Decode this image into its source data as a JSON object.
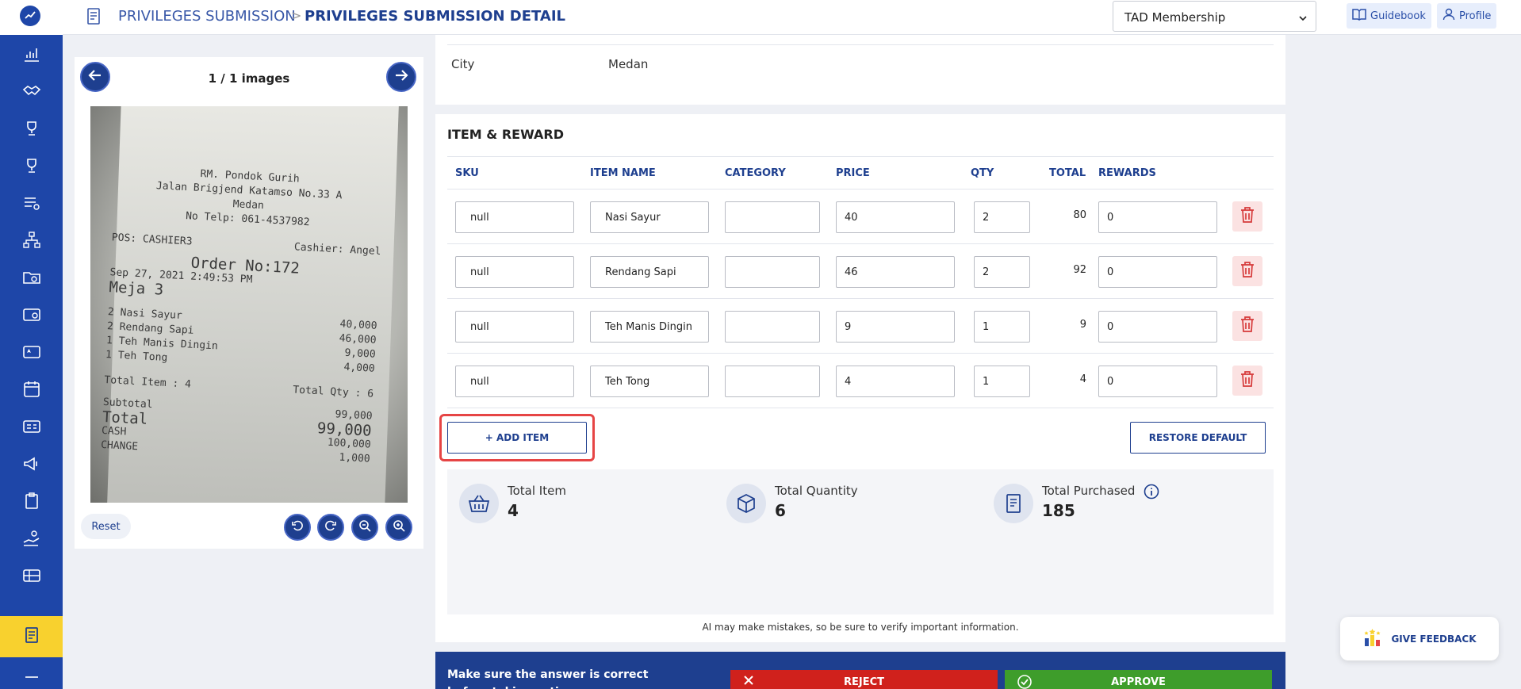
{
  "header": {
    "breadcrumb_parent": "PRIVILEGES SUBMISSION",
    "breadcrumb_separator": ">",
    "breadcrumb_current": "PRIVILEGES SUBMISSION DETAIL",
    "membership_select": "TAD Membership",
    "guidebook_label": "Guidebook",
    "profile_label": "Profile"
  },
  "sidebar": {
    "items": [
      {
        "icon": "chart-icon"
      },
      {
        "icon": "handshake-icon"
      },
      {
        "icon": "trophy-icon"
      },
      {
        "icon": "trophy-icon"
      },
      {
        "icon": "list-settings-icon"
      },
      {
        "icon": "hierarchy-icon"
      },
      {
        "icon": "folder-settings-icon"
      },
      {
        "icon": "card-settings-icon"
      },
      {
        "icon": "card-star-icon"
      },
      {
        "icon": "calendar-settings-icon"
      },
      {
        "icon": "id-card-icon"
      },
      {
        "icon": "megaphone-icon"
      },
      {
        "icon": "clipboard-icon"
      },
      {
        "icon": "hand-coins-icon"
      },
      {
        "icon": "card-gift-icon"
      },
      {
        "icon": "document-icon",
        "active": true
      }
    ]
  },
  "image_viewer": {
    "counter": "1 / 1 images",
    "reset_label": "Reset",
    "receipt": {
      "store": "RM. Pondok Gurih",
      "address": "Jalan Brigjend Katamso No.33 A",
      "city": "Medan",
      "phone": "No Telp: 061-4537982",
      "pos": "POS: CASHIER3",
      "cashier": "Cashier: Angel",
      "order": "Order No:172",
      "datetime": "Sep 27, 2021 2:49:53 PM",
      "table": "Meja 3",
      "lines": [
        {
          "name": "2 Nasi Sayur",
          "amount": "40,000"
        },
        {
          "name": "2 Rendang Sapi",
          "amount": "46,000"
        },
        {
          "name": "1 Teh Manis Dingin",
          "amount": "9,000"
        },
        {
          "name": "1 Teh Tong",
          "amount": "4,000"
        }
      ],
      "total_item": "Total Item : 4",
      "total_qty": "Total Qty : 6",
      "subtotal_label": "Subtotal",
      "subtotal_value": "99,000",
      "total_label": "Total",
      "total_value": "99,000",
      "cash_label": "CASH",
      "cash_value": "100,000",
      "change_label": "CHANGE",
      "change_value": "1,000"
    }
  },
  "details": {
    "city_label": "City",
    "city_value": "Medan"
  },
  "items_section": {
    "title": "ITEM & REWARD",
    "columns": [
      "SKU",
      "ITEM NAME",
      "CATEGORY",
      "PRICE",
      "QTY",
      "TOTAL",
      "REWARDS"
    ],
    "rows": [
      {
        "sku": "null",
        "name": "Nasi Sayur",
        "category": "",
        "price": "40",
        "qty": "2",
        "total": "80",
        "rewards": "0"
      },
      {
        "sku": "null",
        "name": "Rendang Sapi",
        "category": "",
        "price": "46",
        "qty": "2",
        "total": "92",
        "rewards": "0"
      },
      {
        "sku": "null",
        "name": "Teh Manis Dingin",
        "category": "",
        "price": "9",
        "qty": "1",
        "total": "9",
        "rewards": "0"
      },
      {
        "sku": "null",
        "name": "Teh Tong",
        "category": "",
        "price": "4",
        "qty": "1",
        "total": "4",
        "rewards": "0"
      }
    ],
    "add_item_label": "+ ADD ITEM",
    "restore_label": "RESTORE DEFAULT",
    "summary": {
      "total_item_label": "Total Item",
      "total_item_value": "4",
      "total_quantity_label": "Total Quantity",
      "total_quantity_value": "6",
      "total_purchased_label": "Total Purchased",
      "total_purchased_value": "185"
    },
    "ai_note": "AI may make mistakes, so be sure to verify important information."
  },
  "action_bar": {
    "message": "Make sure the answer is correct before taking action",
    "reject_label": "REJECT",
    "approve_label": "APPROVE"
  },
  "feedback_label": "GIVE FEEDBACK",
  "colors": {
    "primary": "#1e3f8f",
    "sidebar": "#1e46a8",
    "active": "#f8d12e",
    "reject": "#d0211c",
    "approve": "#3e9d2b",
    "highlight": "#e64545"
  }
}
